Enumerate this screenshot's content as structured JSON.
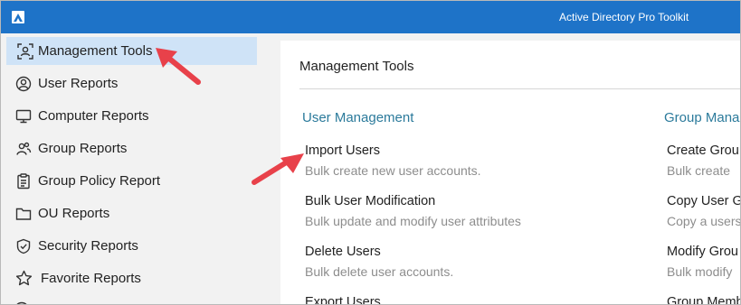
{
  "window": {
    "title": "Active Directory Pro Toolkit"
  },
  "sidebar": {
    "items": [
      {
        "label": "Management Tools",
        "icon": "management-tools-icon",
        "active": true
      },
      {
        "label": "User Reports",
        "icon": "user-icon"
      },
      {
        "label": "Computer Reports",
        "icon": "monitor-icon"
      },
      {
        "label": "Group Reports",
        "icon": "group-icon"
      },
      {
        "label": "Group Policy Report",
        "icon": "clipboard-icon"
      },
      {
        "label": "OU Reports",
        "icon": "folder-icon"
      },
      {
        "label": "Security Reports",
        "icon": "shield-check-icon"
      },
      {
        "label": "Favorite Reports",
        "icon": "star-icon"
      }
    ]
  },
  "main": {
    "title": "Management Tools",
    "sections": [
      {
        "title": "User Management",
        "tools": [
          {
            "name": "Import Users",
            "desc": "Bulk create new user accounts."
          },
          {
            "name": "Bulk User Modification",
            "desc": "Bulk update and modify user attributes"
          },
          {
            "name": "Delete Users",
            "desc": "Bulk delete user accounts."
          },
          {
            "name": "Export Users",
            "desc": ""
          }
        ]
      },
      {
        "title": "Group Mana",
        "tools": [
          {
            "name": "Create Grou",
            "desc": "Bulk create"
          },
          {
            "name": "Copy User G",
            "desc": "Copy a users"
          },
          {
            "name": "Modify Grou",
            "desc": "Bulk modify"
          },
          {
            "name": "Group Memb",
            "desc": ""
          }
        ]
      }
    ]
  },
  "colors": {
    "titlebar": "#1e73c8",
    "active_item": "#cfe3f7",
    "section_title": "#2b7a9b",
    "annotation_arrow": "#e8414a"
  }
}
